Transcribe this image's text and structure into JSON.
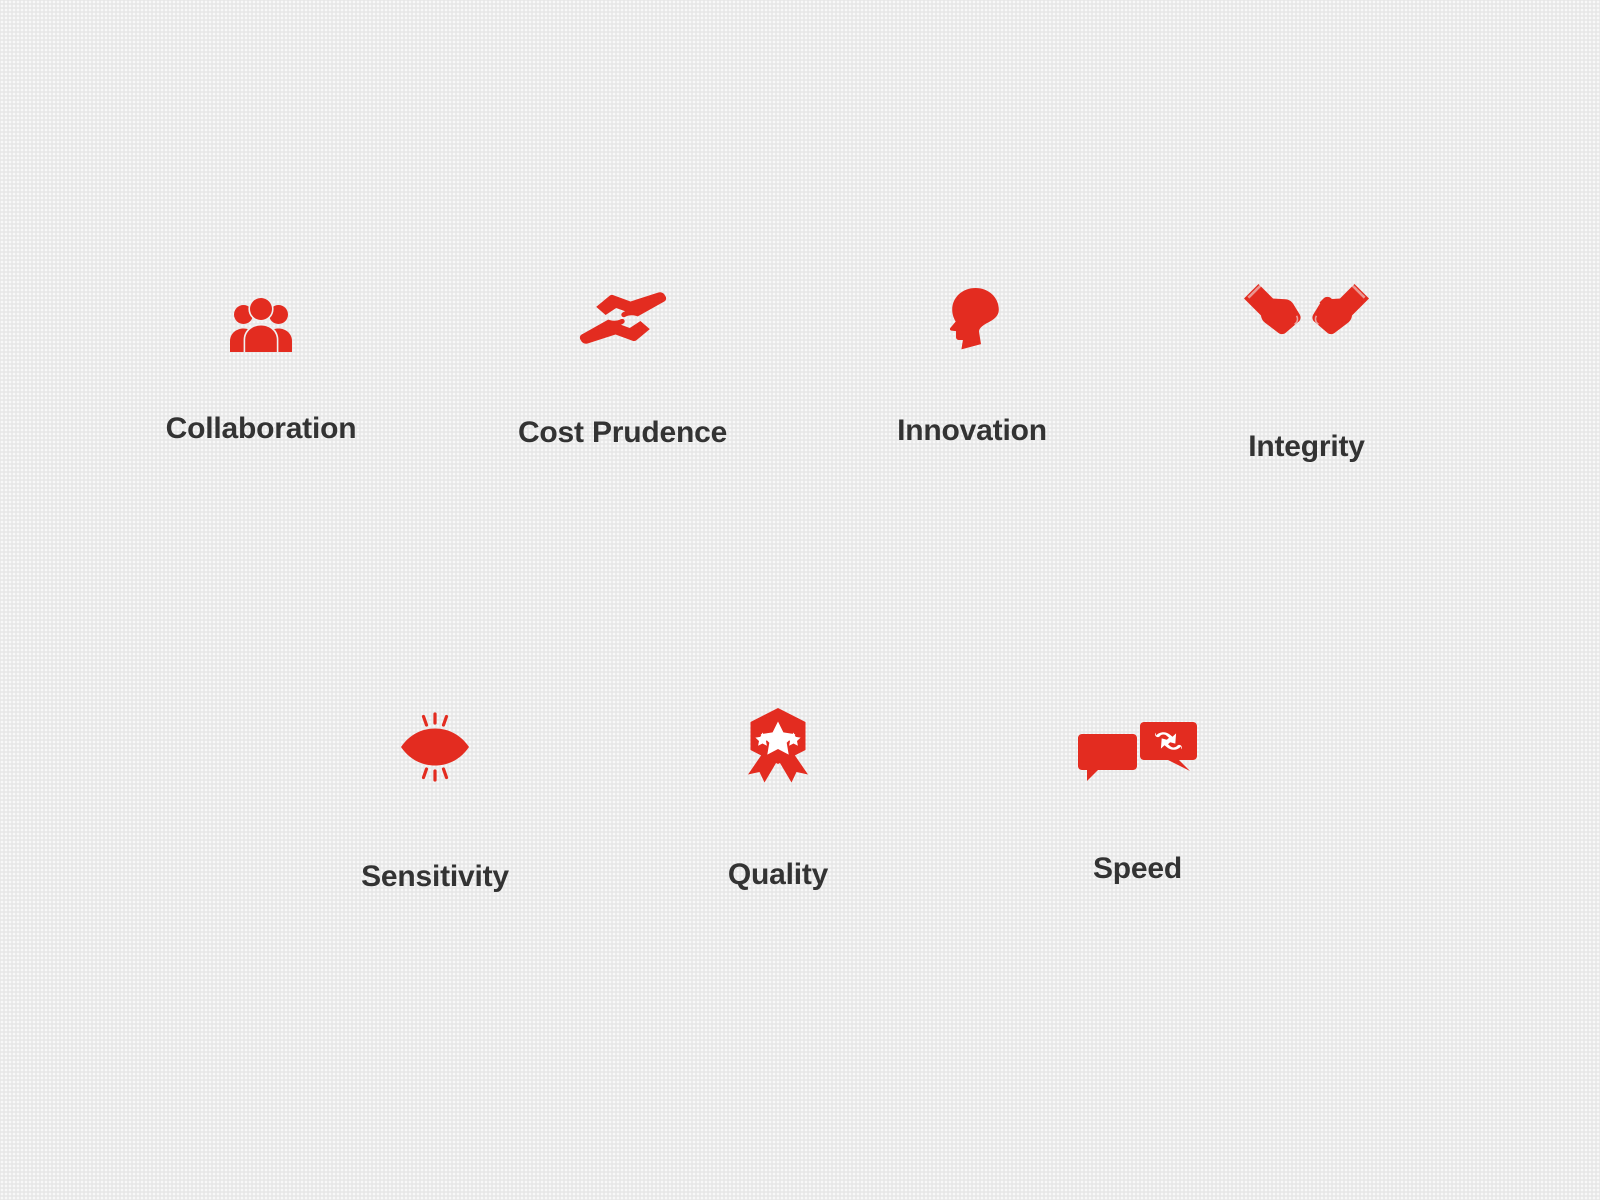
{
  "page": {
    "background_color": "#ebebeb",
    "accent_color": "#e32c20",
    "label_color": "#333333"
  },
  "values": {
    "row1": [
      {
        "label": "Collaboration",
        "icon": "group-of-people-icon",
        "icon_color": "#e32c20"
      },
      {
        "label": "Cost Prudence",
        "icon": "two-hands-exchange-icon",
        "icon_color": "#e32c20"
      },
      {
        "label": "Innovation",
        "icon": "head-profile-icon",
        "icon_color": "#e32c20"
      },
      {
        "label": "Integrity",
        "icon": "fist-bump-icon",
        "icon_color": "#e32c20"
      }
    ],
    "row2": [
      {
        "label": "Sensitivity",
        "icon": "eye-with-lashes-icon",
        "icon_color": "#e32c20"
      },
      {
        "label": "Quality",
        "icon": "award-badge-star-icon",
        "icon_color": "#e32c20"
      },
      {
        "label": "Speed",
        "icon": "chat-bubbles-sync-icon",
        "icon_color": "#e32c20"
      }
    ]
  }
}
